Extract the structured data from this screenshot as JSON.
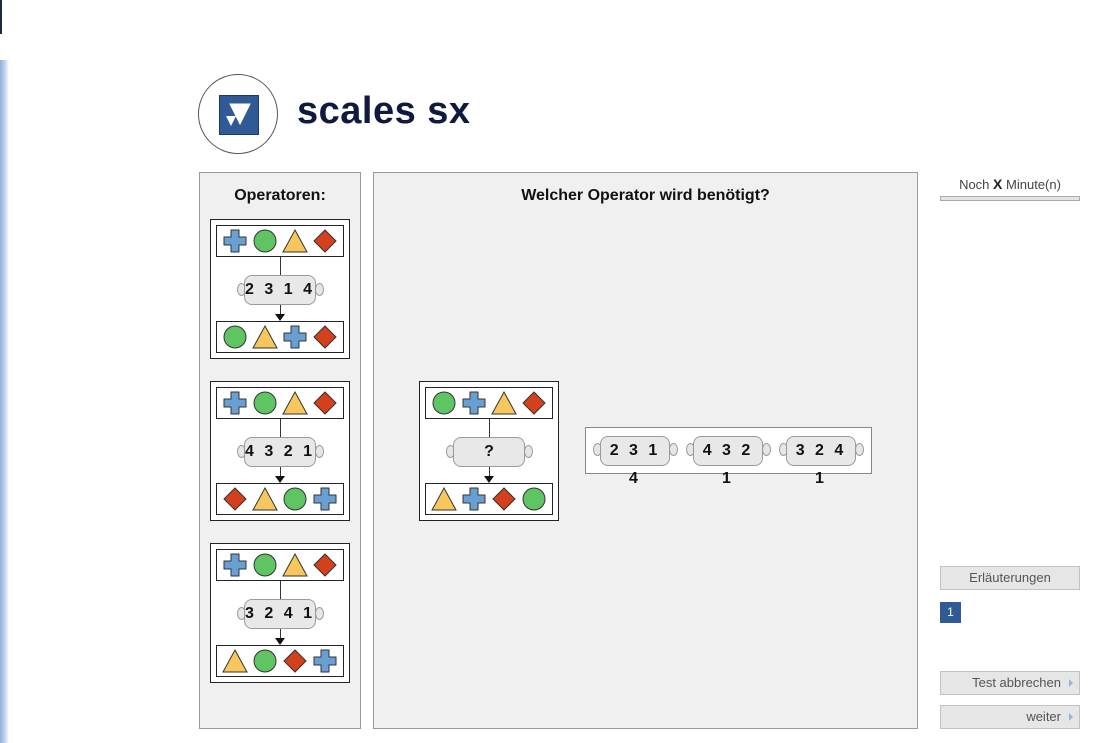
{
  "brand": {
    "title": "scales sx"
  },
  "left_panel": {
    "heading": "Operatoren:"
  },
  "main_panel": {
    "question": "Welcher Operator wird benötigt?"
  },
  "colors": {
    "cross": "#6a9fd4",
    "circle": "#5fc462",
    "triangle": "#f7c65c",
    "diamond": "#d2401c",
    "accent": "#2f5a96"
  },
  "operators": [
    {
      "code": "2 3 1 4",
      "input": [
        "cross",
        "circle",
        "triangle",
        "diamond"
      ],
      "output": [
        "circle",
        "triangle",
        "cross",
        "diamond"
      ]
    },
    {
      "code": "4 3 2 1",
      "input": [
        "cross",
        "circle",
        "triangle",
        "diamond"
      ],
      "output": [
        "diamond",
        "triangle",
        "circle",
        "cross"
      ]
    },
    {
      "code": "3 2 4 1",
      "input": [
        "cross",
        "circle",
        "triangle",
        "diamond"
      ],
      "output": [
        "triangle",
        "circle",
        "diamond",
        "cross"
      ]
    }
  ],
  "question_card": {
    "code": "?",
    "input": [
      "circle",
      "cross",
      "triangle",
      "diamond"
    ],
    "output": [
      "triangle",
      "cross",
      "diamond",
      "circle"
    ]
  },
  "answer_options": [
    "2 3 1 4",
    "4 3 2 1",
    "3 2 4 1"
  ],
  "sidebar": {
    "timer_prefix": "Noch",
    "timer_value": "X",
    "timer_suffix": "Minute(n)",
    "explanations_label": "Erläuterungen",
    "page_number": "1",
    "cancel_label": "Test abbrechen",
    "next_label": "weiter"
  }
}
